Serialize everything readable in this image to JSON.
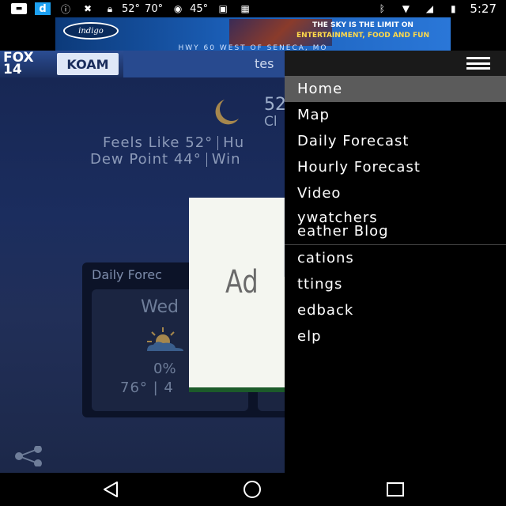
{
  "status_bar": {
    "temp_1": "52°",
    "temp_2": "70°",
    "temp_3": "45°",
    "time": "5:27",
    "d_icon": "d"
  },
  "ad_banner": {
    "logo": "indigo",
    "line1": "THE SKY IS THE LIMIT ON",
    "line2": "ENTERTAINMENT, FOOD AND FUN",
    "footer": "HWY 60 WEST OF SENECA, MO"
  },
  "header": {
    "brand_fox": "FOX 14",
    "brand_cbs": "KOAM",
    "title": "tes"
  },
  "weather": {
    "temp": "52",
    "condition": "Cl",
    "feels_like_label": "Feels Like",
    "feels_like_value": "52°",
    "humidity_label": "Hu",
    "dew_point_label": "Dew Point",
    "dew_point_value": "44°",
    "wind_label": "Win"
  },
  "forecast": {
    "title": "Daily Forec",
    "day": "Wed",
    "precip": "0%",
    "hilo": "76° | 4"
  },
  "ad_overlay": {
    "text": "Ad"
  },
  "drawer": {
    "items": [
      {
        "label": "Home"
      },
      {
        "label": "Map"
      },
      {
        "label": "Daily Forecast"
      },
      {
        "label": "Hourly Forecast"
      },
      {
        "label": "Video"
      },
      {
        "label_1": "ywatchers",
        "label_2": "eather Blog"
      },
      {
        "label": "cations"
      },
      {
        "label": "ttings"
      },
      {
        "label": "edback"
      },
      {
        "label": "elp"
      }
    ]
  },
  "colors": {
    "accent": "#284a8f",
    "menu_active": "#5b5b5b",
    "drawer_bg": "#000000"
  }
}
